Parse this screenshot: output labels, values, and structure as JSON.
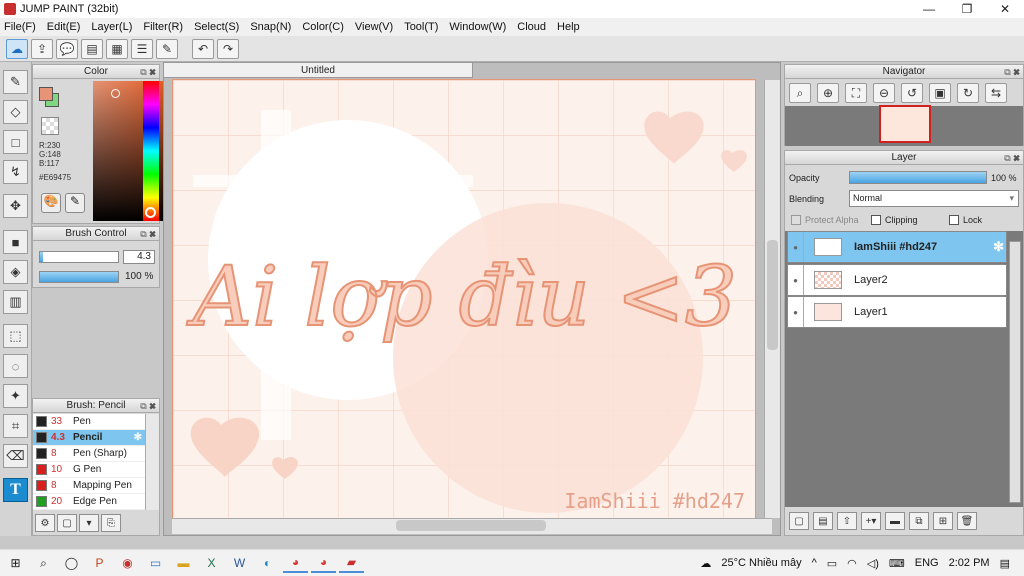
{
  "window": {
    "title": "JUMP PAINT (32bit)",
    "controls": [
      "—",
      "❐",
      "✕"
    ]
  },
  "menu": [
    "File(F)",
    "Edit(E)",
    "Layer(L)",
    "Filter(R)",
    "Select(S)",
    "Snap(N)",
    "Color(C)",
    "View(V)",
    "Tool(T)",
    "Window(W)",
    "Cloud",
    "Help"
  ],
  "color_panel": {
    "title": "Color",
    "r": "R:230",
    "g": "G:148",
    "b": "B:117",
    "hex": "#E69475",
    "current_color": "#e69475"
  },
  "brush_control": {
    "title": "Brush Control",
    "size": "4.3",
    "opacity": "100 %",
    "opacity_fraction": 1.0
  },
  "brush_list": {
    "title": "Brush: Pencil",
    "items": [
      {
        "size": "33",
        "name": "Pen",
        "color": "#222222"
      },
      {
        "size": "4.3",
        "name": "Pencil",
        "color": "#222222",
        "selected": true
      },
      {
        "size": "8",
        "name": "Pen (Sharp)",
        "color": "#222222"
      },
      {
        "size": "10",
        "name": "G Pen",
        "color": "#d92020"
      },
      {
        "size": "8",
        "name": "Mapping Pen",
        "color": "#d92020"
      },
      {
        "size": "20",
        "name": "Edge Pen",
        "color": "#20a020"
      }
    ]
  },
  "document": {
    "tab": "Untitled",
    "artwork_text": "Ai lợp đìu <3",
    "signature": "IamShiii #hd247"
  },
  "navigator": {
    "title": "Navigator"
  },
  "layer_panel": {
    "title": "Layer",
    "opacity_label": "Opacity",
    "opacity_value": "100 %",
    "opacity_fraction": 1.0,
    "blending_label": "Blending",
    "blending_value": "Normal",
    "protect_alpha": "Protect Alpha",
    "clipping": "Clipping",
    "lock": "Lock",
    "layers": [
      {
        "name": "IamShiii #hd247",
        "selected": true
      },
      {
        "name": "Layer2",
        "selected": false
      },
      {
        "name": "Layer1",
        "selected": false
      }
    ]
  },
  "taskbar": {
    "weather": "25°C  Nhiều mây",
    "lang": "ENG",
    "time": "2:02 PM"
  }
}
